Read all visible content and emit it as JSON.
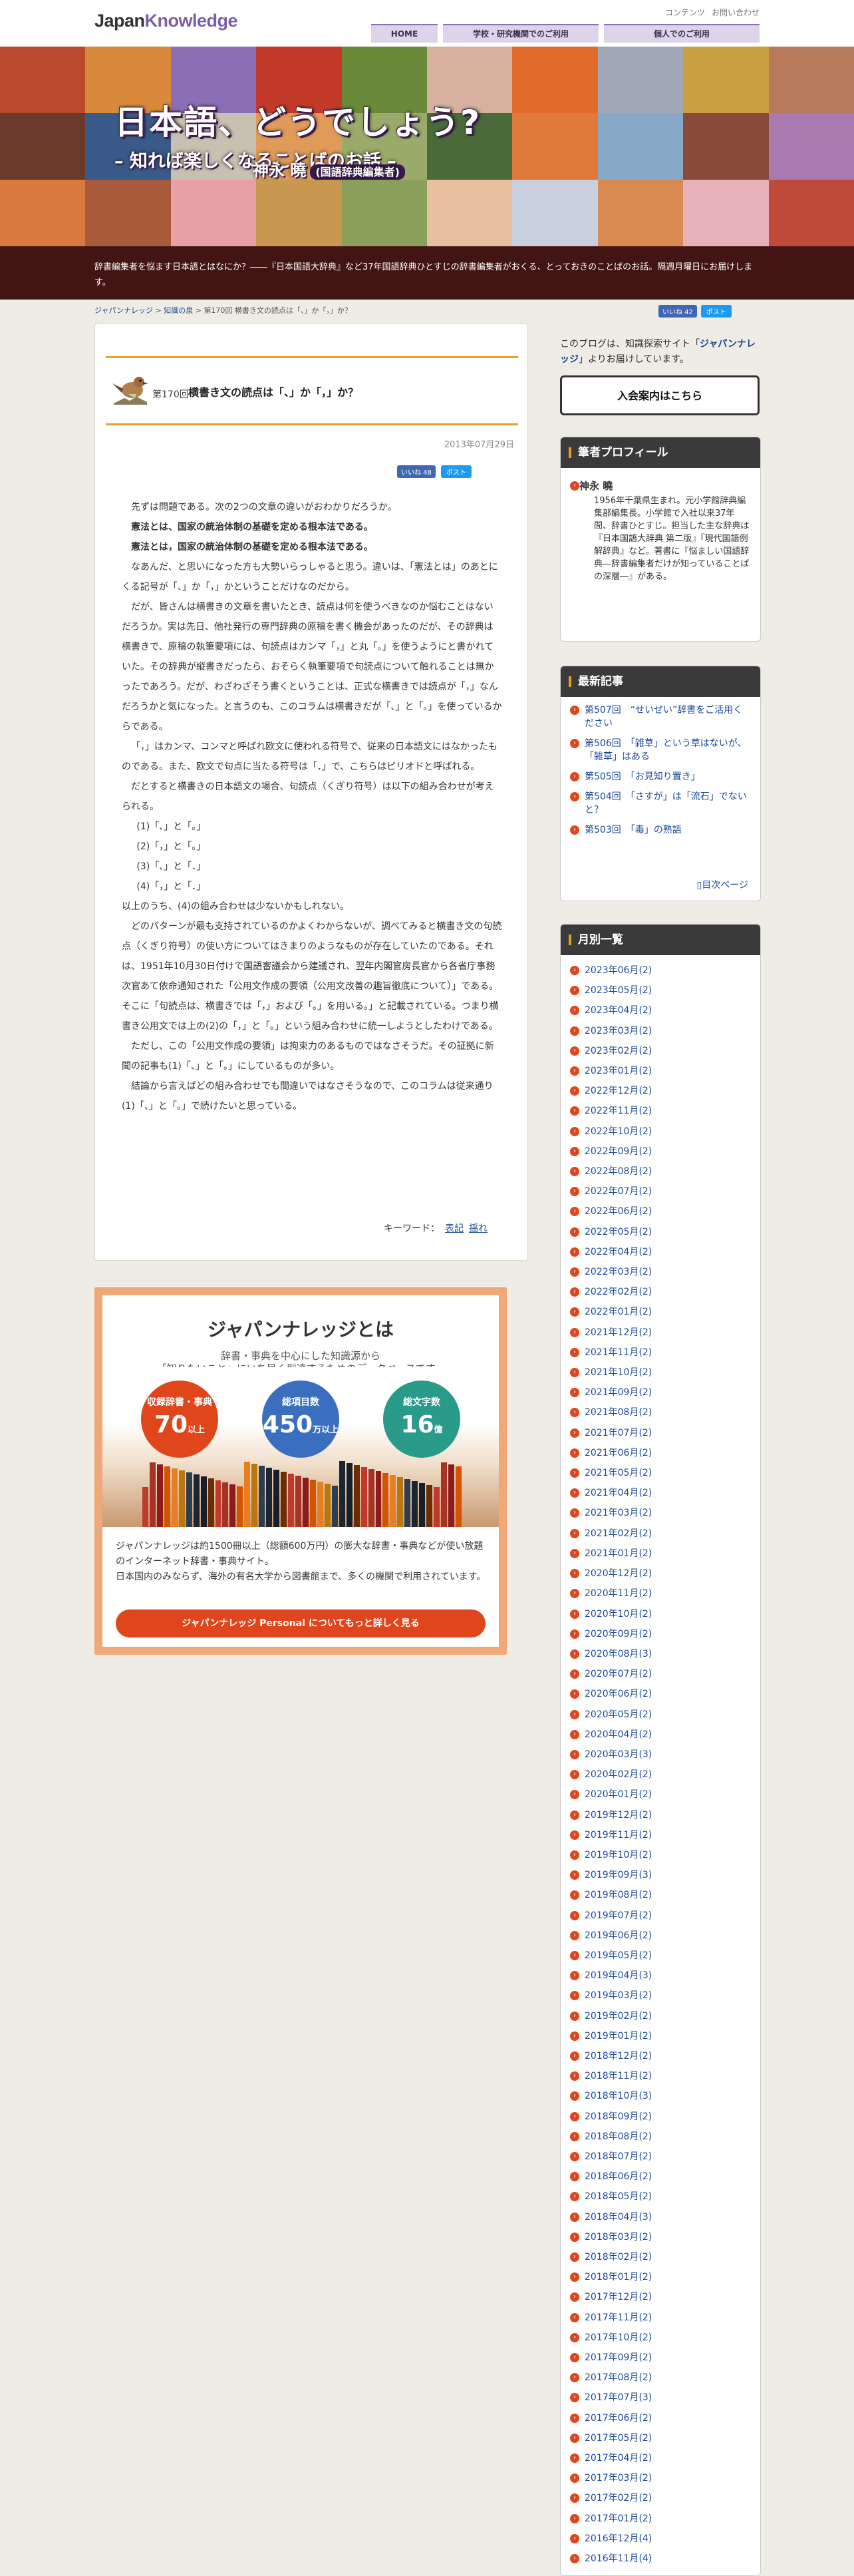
{
  "header": {
    "logo_a": "Japan",
    "logo_b": "Knowledge",
    "util": [
      "コンテンツ",
      "お問い合わせ"
    ],
    "nav": [
      "HOME",
      "学校・研究機関でのご利用",
      "個人でのご利用"
    ]
  },
  "hero": {
    "title": "日本語、どうでしょう?",
    "subtitle": "– 知れば楽しくなることばのお話 –",
    "author": "神永 曉",
    "author_role": "(国語辞典編集者)"
  },
  "intro": "辞書編集者を悩ます日本語とはなにか？――『日本国語大辞典』など37年国語辞典ひとすじの辞書編集者がおくる、とっておきのことばのお話。隔週月曜日にお届けします。",
  "breadcrumb": [
    "ジャパンナレッジ",
    "知識の泉",
    "第170回 横書き文の読点は「、」か「，」か？"
  ],
  "share": {
    "fb_label": "いいね 42",
    "tw_label": "ポスト",
    "fb_article": "いいね 48",
    "tw_article": "ポスト"
  },
  "article": {
    "episode": "第170回",
    "title": "横書き文の読点は「、」か「，」か？",
    "date": "2013年07月29日",
    "paragraphs": [
      {
        "t": "先ずは問題である。次の2つの文章の違いがおわかりだろうか。",
        "s": ""
      },
      {
        "t": "憲法とは、国家の統治体制の基礎を定める根本法である。",
        "s": "b"
      },
      {
        "t": "憲法とは，国家の統治体制の基礎を定める根本法である。",
        "s": "b"
      },
      {
        "t": "なあんだ、と思いになった方も大勢いらっしゃると思う。違いは、「憲法とは」のあとにくる記号が「、」か「，」かということだけなのだから。",
        "s": ""
      },
      {
        "t": "だが、皆さんは横書きの文章を書いたとき、読点は何を使うべきなのか悩むことはないだろうか。実は先日、他社発行の専門辞典の原稿を書く機会があったのだが、その辞典は横書きで、原稿の執筆要項には、句読点はカンマ「，」と丸「。」を使うようにと書かれていた。その辞典が縦書きだったら、おそらく執筆要項で句読点について触れることは無かったであろう。だが、わざわざそう書くということは、正式な横書きでは読点が「，」なんだろうかと気になった。と言うのも、このコラムは横書きだが「、」と「。」を使っているからである。",
        "s": ""
      },
      {
        "t": "「，」はカンマ、コンマと呼ばれ欧文に使われる符号で、従来の日本語文にはなかったものである。また、欧文で句点に当たる符号は「．」で、こちらはピリオドと呼ばれる。",
        "s": ""
      },
      {
        "t": "だとすると横書きの日本語文の場合、句読点（くぎり符号）は以下の組み合わせが考えられる。",
        "s": ""
      },
      {
        "t": "(1)「、」と「。」",
        "s": "l"
      },
      {
        "t": "(2)「，」と「。」",
        "s": "l"
      },
      {
        "t": "(3)「、」と「．」",
        "s": "l"
      },
      {
        "t": "(4)「，」と「．」",
        "s": "l"
      },
      {
        "t": "以上のうち、(4)の組み合わせは少ないかもしれない。",
        "s": "n"
      },
      {
        "t": "どのパターンが最も支持されているのかよくわからないが、調べてみると横書き文の句読点（くぎり符号）の使い方についてはきまりのようなものが存在していたのである。それは、1951年10月30日付けで国語審議会から建議され、翌年内閣官房長官から各省庁事務次官あて依命通知された「公用文作成の要領（公用文改善の趣旨徹底について）」である。そこに「句読点は、横書きでは「，」および「。」を用いる。」と記載されている。つまり横書き公用文では上の(2)の「，」と「。」という組み合わせに統一しようとしたわけである。",
        "s": ""
      },
      {
        "t": "ただし、この「公用文作成の要領」は拘束力のあるものではなさそうだ。その証拠に新聞の記事も(1)「、」と「。」にしているものが多い。",
        "s": ""
      },
      {
        "t": "結論から言えばどの組み合わせでも間違いではなさそうなので、このコラムは従来通り(1)「、」と「。」で続けたいと思っている。",
        "s": ""
      }
    ],
    "keywords_label": "キーワード：",
    "keywords": [
      "表記",
      "揺れ"
    ]
  },
  "ad": {
    "title": "ジャパンナレッジとは",
    "lead1": "辞書・事典を中心にした知識源から",
    "lead2": "「知りたいこと」にいち早く到達するためのデータベースです。",
    "stats": [
      {
        "label": "収録辞書・事典",
        "value": "70",
        "unit": "以上",
        "color": "#e0461c"
      },
      {
        "label": "総項目数",
        "value": "450",
        "unit": "万以上",
        "color": "#3a6fc0"
      },
      {
        "label": "総文字数",
        "value": "16",
        "unit": "億",
        "color": "#2a9a8a"
      }
    ],
    "text1": "ジャパンナレッジは約1500冊以上（総額600万円）の膨大な辞書・事典などが使い放題のインターネット辞書・事典サイト。",
    "text2": "日本国内のみならず、海外の有名大学から図書館まで、多くの機関で利用されています。",
    "button": "ジャパンナレッジ Personal についてもっと詳しく見る"
  },
  "sidebar": {
    "note_a": "このブログは、知識探索サイト「",
    "note_b": "ジャパンナレッジ",
    "note_c": "」よりお届けしています。",
    "join": "入会案内はこちら",
    "profile_title": "筆者プロフィール",
    "profile_name": "神永 曉",
    "profile_text": "1956年千葉県生まれ。元小学館辞典編集部編集長。小学館で入社以来37年間、辞書ひとすじ。担当した主な辞典は『日本国語大辞典 第二版』『現代国語例解辞典』など。著書に『悩ましい国語辞典―辞書編集者だけが知っていることばの深層―』がある。",
    "latest_title": "最新記事",
    "latest": [
      "第507回　“せいぜい”辞書をご活用ください",
      "第506回　「雑草」という草はないが、「雑草」はある",
      "第505回　「お見知り置き」",
      "第504回　「さすが」は「流石」でないと？",
      "第503回　「毒」の熟語"
    ],
    "more": "目次ページ",
    "monthly_title": "月別一覧",
    "months": [
      "2023年06月(2)",
      "2023年05月(2)",
      "2023年04月(2)",
      "2023年03月(2)",
      "2023年02月(2)",
      "2023年01月(2)",
      "2022年12月(2)",
      "2022年11月(2)",
      "2022年10月(2)",
      "2022年09月(2)",
      "2022年08月(2)",
      "2022年07月(2)",
      "2022年06月(2)",
      "2022年05月(2)",
      "2022年04月(2)",
      "2022年03月(2)",
      "2022年02月(2)",
      "2022年01月(2)",
      "2021年12月(2)",
      "2021年11月(2)",
      "2021年10月(2)",
      "2021年09月(2)",
      "2021年08月(2)",
      "2021年07月(2)",
      "2021年06月(2)",
      "2021年05月(2)",
      "2021年04月(2)",
      "2021年03月(2)",
      "2021年02月(2)",
      "2021年01月(2)",
      "2020年12月(2)",
      "2020年11月(2)",
      "2020年10月(2)",
      "2020年09月(2)",
      "2020年08月(3)",
      "2020年07月(2)",
      "2020年06月(2)",
      "2020年05月(2)",
      "2020年04月(2)",
      "2020年03月(3)",
      "2020年02月(2)",
      "2020年01月(2)",
      "2019年12月(2)",
      "2019年11月(2)",
      "2019年10月(2)",
      "2019年09月(3)",
      "2019年08月(2)",
      "2019年07月(2)",
      "2019年06月(2)",
      "2019年05月(2)",
      "2019年04月(3)",
      "2019年03月(2)",
      "2019年02月(2)",
      "2019年01月(2)",
      "2018年12月(2)",
      "2018年11月(2)",
      "2018年10月(3)",
      "2018年09月(2)",
      "2018年08月(2)",
      "2018年07月(2)",
      "2018年06月(2)",
      "2018年05月(2)",
      "2018年04月(3)",
      "2018年03月(2)",
      "2018年02月(2)",
      "2018年01月(2)",
      "2017年12月(2)",
      "2017年11月(2)",
      "2017年10月(2)",
      "2017年09月(2)",
      "2017年08月(2)",
      "2017年07月(3)",
      "2017年06月(2)",
      "2017年05月(2)",
      "2017年04月(2)",
      "2017年03月(2)",
      "2017年02月(2)",
      "2017年01月(2)",
      "2016年12月(4)",
      "2016年11月(4)"
    ]
  }
}
